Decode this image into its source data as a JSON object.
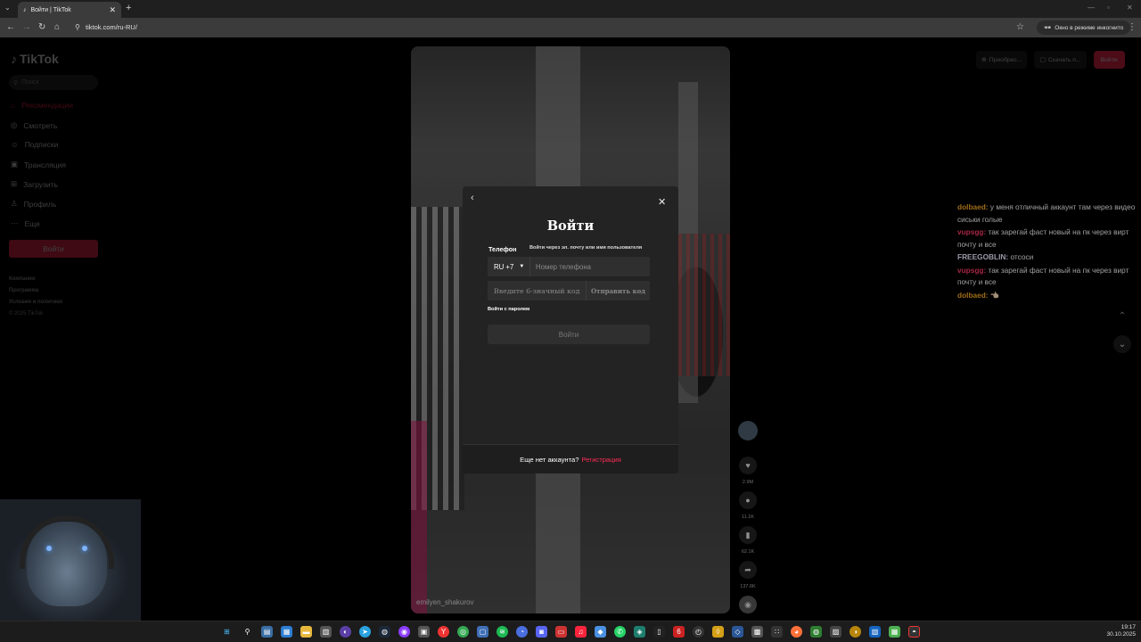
{
  "browser": {
    "tab_title": "Войти | TikTok",
    "url": "tiktok.com/ru-RU/",
    "incognito_label": "Окно в режиме инкогнито"
  },
  "sidebar": {
    "brand": "TikTok",
    "search_placeholder": "Поиск",
    "items": [
      {
        "label": "Рекомендации",
        "icon": "home-icon"
      },
      {
        "label": "Смотреть",
        "icon": "compass-icon"
      },
      {
        "label": "Подписки",
        "icon": "user-icon"
      },
      {
        "label": "Трансляция",
        "icon": "live-icon"
      },
      {
        "label": "Загрузить",
        "icon": "upload-icon"
      },
      {
        "label": "Профиль",
        "icon": "profile-icon"
      },
      {
        "label": "Еще",
        "icon": "more-icon"
      }
    ],
    "login_label": "Войти",
    "footer": [
      "Компания",
      "Программа",
      "Условия и политики",
      "© 2025 TikTok"
    ]
  },
  "top_right": {
    "get_coins": "Приобрес...",
    "download": "Скачать п...",
    "login": "Войти"
  },
  "video": {
    "username": "emilyen_shakurov"
  },
  "rail": {
    "likes": "2.9M",
    "comments": "11.1K",
    "saves": "62.1K",
    "shares": "137.6K"
  },
  "modal": {
    "title": "Войти",
    "phone_label": "Телефон",
    "alt_login": "Войти через эл. почту или имя пользователя",
    "country_code": "RU +7",
    "phone_placeholder": "Номер телефона",
    "code_placeholder": "Введите 6-значный код",
    "send_code": "Отправить код",
    "password_login": "Войти с паролем",
    "submit": "Войти",
    "no_account": "Еще нет аккаунта?",
    "signup": "Регистрация"
  },
  "chat": [
    {
      "user": "dolbaed:",
      "color": "#f5a623",
      "text": "у меня отличный аккаунт там через видео сиськи голые"
    },
    {
      "user": "vupsgg:",
      "color": "#ff3b6b",
      "text": "так зарегай фаст новый на пк через вирт почту и все"
    },
    {
      "user": "FREEGOBLIN:",
      "color": "#e8e8ff",
      "text": "отсоси"
    },
    {
      "user": "vupsgg:",
      "color": "#ff3b6b",
      "text": "так зарегай фаст новый на пк через вирт почту и все"
    },
    {
      "user": "dolbaed:",
      "color": "#f5a623",
      "text": "👈🏻"
    }
  ],
  "taskbar": {
    "time": "19:17",
    "date": "30.10.2025"
  },
  "colors": {
    "accent": "#fe2c55"
  }
}
